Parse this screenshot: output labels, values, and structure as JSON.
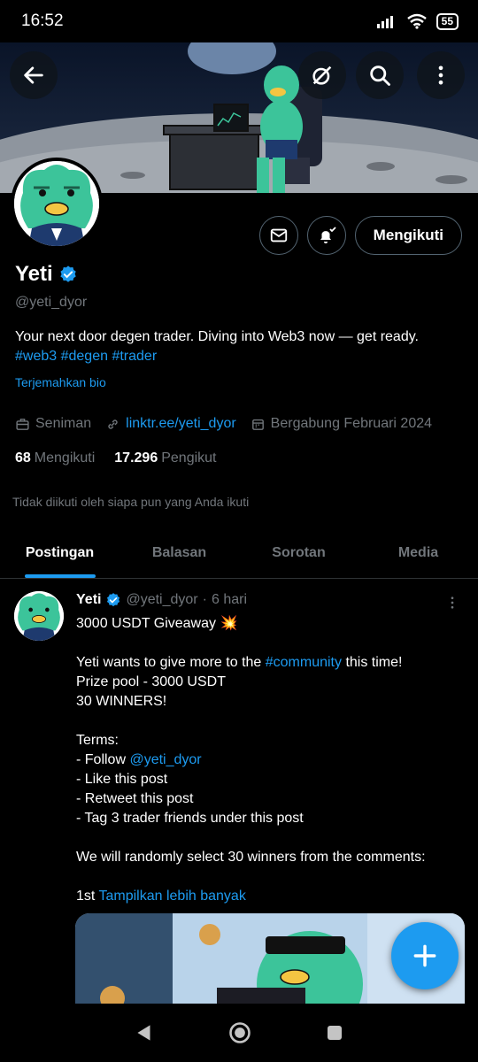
{
  "status_bar": {
    "time": "16:52",
    "battery": "55"
  },
  "profile": {
    "name": "Yeti",
    "handle": "@yeti_dyor",
    "bio_text": "Your next door degen trader.  Diving into Web3 now — get ready.",
    "bio_tags": [
      "#web3",
      "#degen",
      "#trader"
    ],
    "translate_label": "Terjemahkan bio",
    "category": "Seniman",
    "link": "linktr.ee/yeti_dyor",
    "joined": "Bergabung Februari 2024",
    "following_count": "68",
    "following_label": "Mengikuti",
    "followers_count": "17.296",
    "followers_label": "Pengikut",
    "not_followed_note": "Tidak diikuti oleh siapa pun yang Anda ikuti",
    "follow_button": "Mengikuti"
  },
  "tabs": [
    "Postingan",
    "Balasan",
    "Sorotan",
    "Media"
  ],
  "post": {
    "author": "Yeti",
    "handle": "@yeti_dyor",
    "dot": "·",
    "time": "6 hari",
    "line1": "3000 USDT Giveaway 💥",
    "line2_pre": "Yeti wants to give more to the ",
    "line2_tag": "#community",
    "line2_post": " this time!",
    "line3": "Prize pool - 3000 USDT",
    "line4": "30 WINNERS!",
    "terms": "Terms:",
    "term1_pre": "- Follow ",
    "term1_mention": "@yeti_dyor",
    "term2": "- Like this post",
    "term3": "- Retweet this post",
    "term4": "- Tag 3 trader friends under this post",
    "line5": "We will randomly select 30 winners from the comments:",
    "line6_pre": "1st ",
    "show_more": "Tampilkan lebih banyak"
  },
  "colors": {
    "accent": "#1d9bf0",
    "background": "#000000",
    "muted": "#71767b",
    "yeti_green": "#3cc49a"
  }
}
